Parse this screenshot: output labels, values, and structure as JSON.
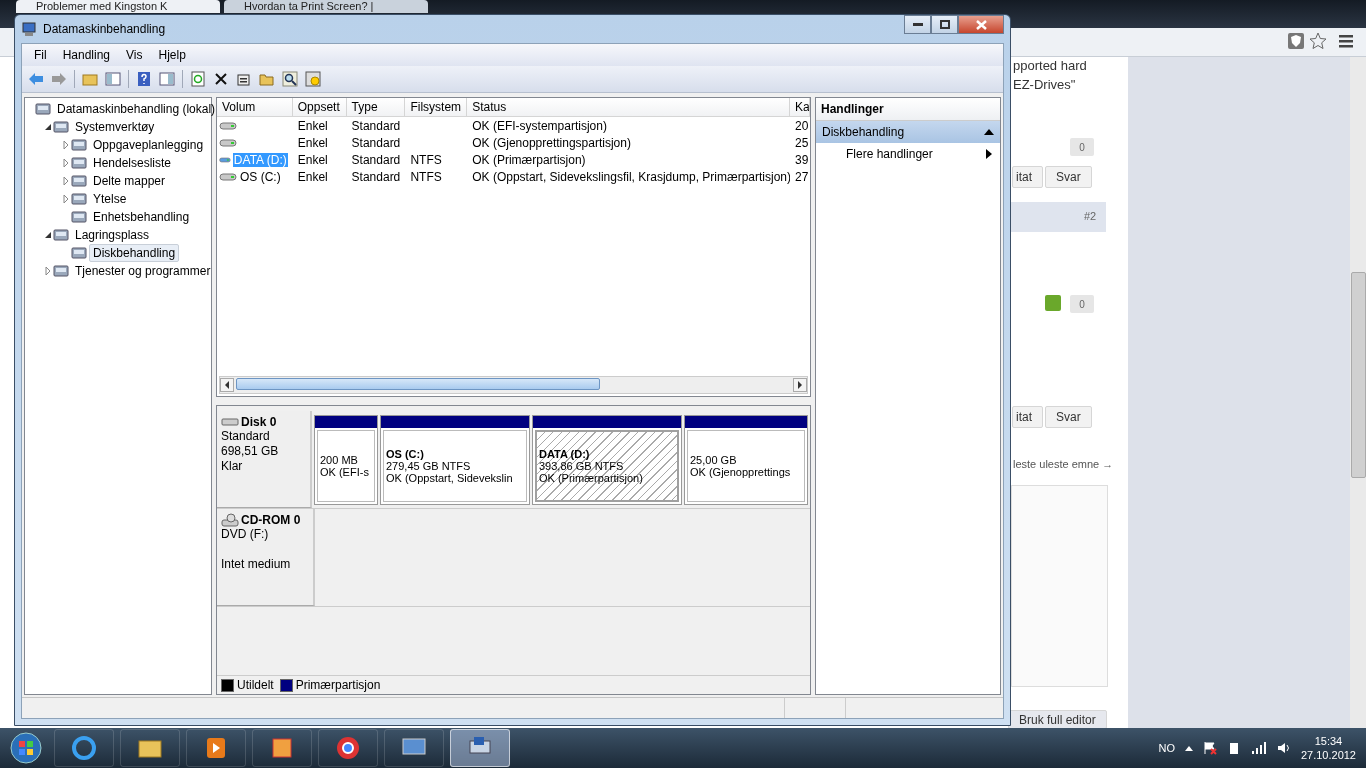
{
  "browser": {
    "tabs": [
      {
        "title": "Problemer med Kingston K",
        "selected": true
      },
      {
        "title": "Hvordan ta Print Screen? | ",
        "selected": false
      }
    ],
    "post_lines": [
      "pported hard",
      "EZ-Drives\""
    ],
    "posts": [
      {
        "votes": "0",
        "upvote": false,
        "buttons": [
          "itat",
          "Svar"
        ]
      },
      {
        "number": "#2",
        "votes": "0",
        "upvote": true,
        "buttons": [
          "itat",
          "Svar"
        ]
      }
    ],
    "nav_link": "leste uleste emne →",
    "editor_button": "Bruk full editor"
  },
  "window": {
    "title": "Datamaskinbehandling",
    "menu": [
      "Fil",
      "Handling",
      "Vis",
      "Hjelp"
    ],
    "tree": [
      {
        "label": "Datamaskinbehandling (lokal)",
        "selected": false,
        "children": [
          {
            "label": "Systemverktøy",
            "expanded": true,
            "selected": false,
            "children": [
              {
                "label": "Oppgaveplanlegging",
                "expanded": false,
                "selected": false
              },
              {
                "label": "Hendelsesliste",
                "expanded": false,
                "selected": false
              },
              {
                "label": "Delte mapper",
                "expanded": false,
                "selected": false
              },
              {
                "label": "Ytelse",
                "expanded": false,
                "selected": false
              },
              {
                "label": "Enhetsbehandling",
                "selected": false
              }
            ]
          },
          {
            "label": "Lagringsplass",
            "expanded": true,
            "selected": false,
            "children": [
              {
                "label": "Diskbehandling",
                "selected": true
              }
            ]
          },
          {
            "label": "Tjenester og programmer",
            "expanded": false,
            "selected": false
          }
        ]
      }
    ],
    "table": {
      "columns": [
        "Volum",
        "Oppsett",
        "Type",
        "Filsystem",
        "Status",
        "Ka"
      ],
      "rows": [
        {
          "selected": false,
          "cells": [
            "",
            "Enkel",
            "Standard",
            "",
            "OK (EFI-systempartisjon)",
            "20"
          ]
        },
        {
          "selected": false,
          "cells": [
            "",
            "Enkel",
            "Standard",
            "",
            "OK (Gjenopprettingspartisjon)",
            "25"
          ]
        },
        {
          "selected": true,
          "cells": [
            "DATA (D:)",
            "Enkel",
            "Standard",
            "NTFS",
            "OK (Primærpartisjon)",
            "39"
          ]
        },
        {
          "selected": false,
          "cells": [
            "OS (C:)",
            "Enkel",
            "Standard",
            "NTFS",
            "OK (Oppstart, Sidevekslingsfil, Krasjdump, Primærpartisjon)",
            "27"
          ]
        }
      ]
    },
    "actions": {
      "title": "Handlinger",
      "section": "Diskbehandling",
      "expanded": true,
      "items": [
        "Flere handlinger"
      ]
    },
    "disks": [
      {
        "kind": "disk",
        "name": "Disk 0",
        "lines": [
          "Standard",
          "698,51 GB",
          "Klar"
        ],
        "partitions": [
          {
            "size": "200 MB",
            "status": "OK (EFI-s",
            "selected": false
          },
          {
            "name": "OS  (C:)",
            "size": "279,45 GB NTFS",
            "status": "OK (Oppstart, Sidevekslin",
            "selected": false
          },
          {
            "name": "DATA  (D:)",
            "size": "393,86 GB NTFS",
            "status": "OK (Primærpartisjon)",
            "selected": true
          },
          {
            "size": "25,00 GB",
            "status": "OK (Gjenopprettings",
            "selected": false
          }
        ]
      },
      {
        "kind": "cdrom",
        "name": "CD-ROM 0",
        "lines": [
          "DVD (F:)",
          "Intet medium"
        ]
      }
    ],
    "legend": [
      {
        "label": "Utildelt",
        "color": "#000000"
      },
      {
        "label": "Primærpartisjon",
        "color": "#000080"
      }
    ]
  },
  "taskbar": {
    "apps": [
      {
        "selected": false
      },
      {
        "selected": false
      },
      {
        "selected": false
      },
      {
        "selected": false
      },
      {
        "selected": false
      },
      {
        "selected": false
      },
      {
        "selected": true
      }
    ],
    "language": "NO",
    "time": "15:34",
    "date": "27.10.2012"
  }
}
